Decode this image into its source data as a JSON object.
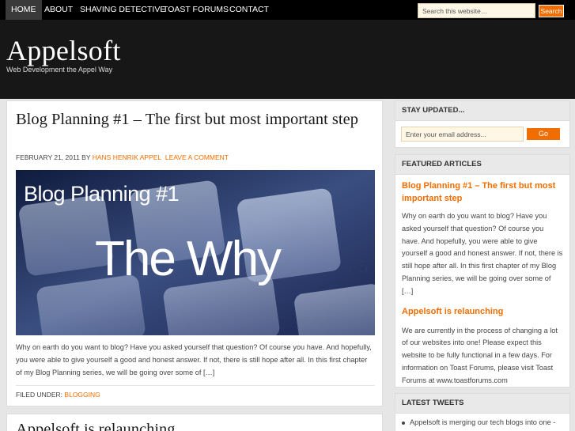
{
  "nav": {
    "items": [
      {
        "label": "HOME",
        "active": true
      },
      {
        "label": "ABOUT"
      },
      {
        "label": "SHAVING DETECTIVE"
      },
      {
        "label": "TOAST FORUMS"
      },
      {
        "label": "CONTACT"
      }
    ],
    "search_placeholder": "Search this website…",
    "search_button": "Search"
  },
  "header": {
    "title": "Appelsoft",
    "description": "Web Development the Appel Way"
  },
  "posts": [
    {
      "title": "Blog Planning #1 – The first but most important step",
      "date": "FEBRUARY 21, 2011",
      "by": "BY",
      "author": "HANS HENRIK APPEL",
      "comment_link": "LEAVE A COMMENT",
      "image_caption_line1": "Blog Planning #1",
      "image_caption_line2": "The Why",
      "excerpt": "Why on earth do you want to blog? Have you asked yourself that question? Of course you have. And hopefully, you were able to give yourself a good and honest answer. If not, there is still hope after all. In this first chapter of my Blog Planning series, we will be going over some of […]",
      "filed_label": "FILED UNDER:",
      "category": "BLOGGING"
    },
    {
      "title": "Appelsoft is relaunching"
    }
  ],
  "sidebar": {
    "stay_updated": {
      "heading": "STAY UPDATED...",
      "email_placeholder": "Enter your email address...",
      "go_label": "Go"
    },
    "featured": {
      "heading": "FEATURED ARTICLES",
      "articles": [
        {
          "title": "Blog Planning #1 – The first but most important step",
          "text": "Why on earth do you want to blog? Have you asked yourself that question? Of course you have. And hopefully, you were able to give yourself a good and honest answer. If not, there is still hope after all. In this first chapter of my Blog Planning series, we will be going over some of […]"
        },
        {
          "title": "Appelsoft is relaunching",
          "text": "We are currently in the process of changing a lot of our websites into one! Please expect this website to be fully functional in a few days. For information on Toast Forums, please visit Toast Forums at www.toastforums.com"
        }
      ]
    },
    "tweets": {
      "heading": "LATEST TWEETS",
      "items": [
        "Appelsoft is merging our tech blogs into one -"
      ]
    }
  },
  "colors": {
    "accent": "#f26d00",
    "nav_bg": "#000000",
    "header_bg": "#171717",
    "page_bg": "#e6e6e6"
  }
}
